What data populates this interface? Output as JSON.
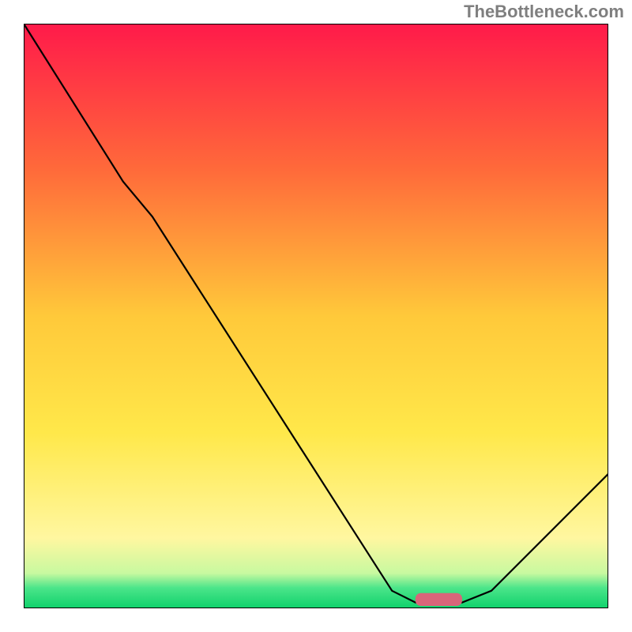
{
  "watermark": "TheBottleneck.com",
  "chart_data": {
    "type": "line",
    "title": "",
    "xlabel": "",
    "ylabel": "",
    "xlim": [
      0,
      100
    ],
    "ylim": [
      0,
      100
    ],
    "background_gradient": {
      "stops": [
        {
          "offset": 0.0,
          "color": "#ff1a4a"
        },
        {
          "offset": 0.25,
          "color": "#ff6a3a"
        },
        {
          "offset": 0.5,
          "color": "#ffc93a"
        },
        {
          "offset": 0.7,
          "color": "#ffe84a"
        },
        {
          "offset": 0.88,
          "color": "#fff7a0"
        },
        {
          "offset": 0.94,
          "color": "#c8f9a0"
        },
        {
          "offset": 0.965,
          "color": "#4be58a"
        },
        {
          "offset": 1.0,
          "color": "#0fd16b"
        }
      ]
    },
    "series": [
      {
        "name": "bottleneck-curve",
        "color": "#000000",
        "points": [
          {
            "x": 0,
            "y": 100
          },
          {
            "x": 17,
            "y": 73
          },
          {
            "x": 22,
            "y": 67
          },
          {
            "x": 63,
            "y": 3
          },
          {
            "x": 67,
            "y": 1
          },
          {
            "x": 75,
            "y": 1
          },
          {
            "x": 80,
            "y": 3
          },
          {
            "x": 100,
            "y": 23
          }
        ]
      }
    ],
    "marker": {
      "name": "optimal-range-marker",
      "x": 71,
      "y": 1.5,
      "width": 8,
      "height": 2.2,
      "color": "#d9657a"
    },
    "axes": {
      "show_ticks": false,
      "show_grid": false,
      "frame_color": "#000000"
    }
  }
}
